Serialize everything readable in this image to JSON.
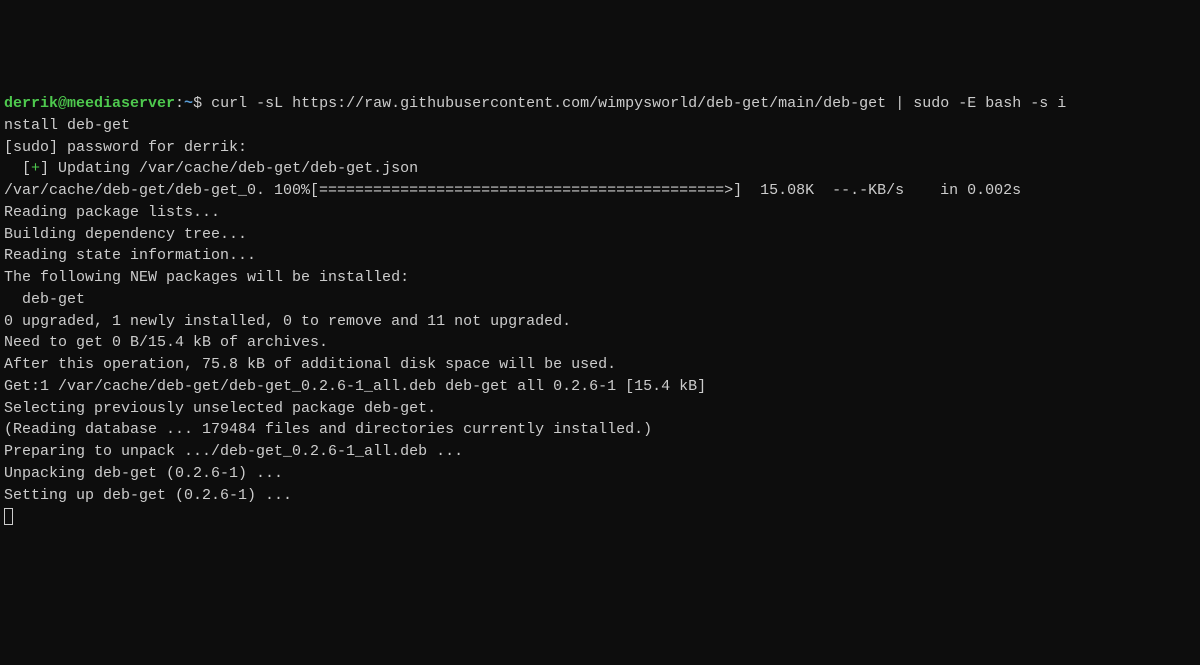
{
  "prompt": {
    "user_host": "derrik@meediaserver",
    "colon": ":",
    "path": "~",
    "dollar": "$ "
  },
  "command": "curl -sL https://raw.githubusercontent.com/wimpysworld/deb-get/main/deb-get | sudo -E bash -s i",
  "lines": {
    "l1": "nstall deb-get",
    "l2": "[sudo] password for derrik:",
    "l3_pre": "  [",
    "l3_plus": "+",
    "l3_post": "] Updating /var/cache/deb-get/deb-get.json",
    "l4": "/var/cache/deb-get/deb-get_0. 100%[=============================================>]  15.08K  --.-KB/s    in 0.002s",
    "l5": "Reading package lists...",
    "l6": "Building dependency tree...",
    "l7": "Reading state information...",
    "l8": "The following NEW packages will be installed:",
    "l9": "  deb-get",
    "l10": "0 upgraded, 1 newly installed, 0 to remove and 11 not upgraded.",
    "l11": "Need to get 0 B/15.4 kB of archives.",
    "l12": "After this operation, 75.8 kB of additional disk space will be used.",
    "l13": "Get:1 /var/cache/deb-get/deb-get_0.2.6-1_all.deb deb-get all 0.2.6-1 [15.4 kB]",
    "l14": "Selecting previously unselected package deb-get.",
    "l15": "(Reading database ... 179484 files and directories currently installed.)",
    "l16": "Preparing to unpack .../deb-get_0.2.6-1_all.deb ...",
    "l17": "Unpacking deb-get (0.2.6-1) ...",
    "l18": "Setting up deb-get (0.2.6-1) ..."
  }
}
